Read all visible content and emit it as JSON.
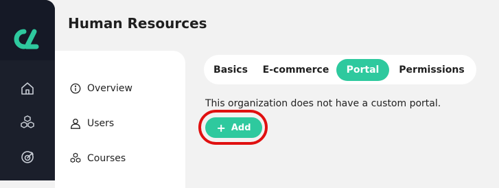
{
  "page": {
    "title": "Human Resources"
  },
  "rail": {
    "logo": "logo-icon",
    "nav": [
      {
        "name": "home-icon"
      },
      {
        "name": "cubes-icon"
      },
      {
        "name": "target-icon"
      }
    ]
  },
  "sidebar": {
    "items": [
      {
        "label": "Overview",
        "icon": "info-icon"
      },
      {
        "label": "Users",
        "icon": "user-icon"
      },
      {
        "label": "Courses",
        "icon": "cubes-icon"
      }
    ]
  },
  "tabs": [
    {
      "label": "Basics",
      "active": false
    },
    {
      "label": "E-commerce",
      "active": false
    },
    {
      "label": "Portal",
      "active": true
    },
    {
      "label": "Permissions",
      "active": false
    }
  ],
  "portal": {
    "message": "This organization does not have a custom portal.",
    "add_label": "Add",
    "add_icon": "plus-icon"
  },
  "colors": {
    "accent": "#2ec99e",
    "rail": "#1b1f2b",
    "highlight": "#e01010"
  }
}
